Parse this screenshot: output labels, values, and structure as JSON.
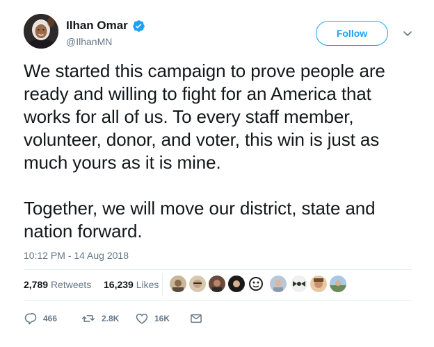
{
  "author": {
    "name": "Ilhan Omar",
    "handle": "@IlhanMN",
    "verified": true,
    "avatar_icon": "profile-photo"
  },
  "follow_label": "Follow",
  "tweet": {
    "paragraphs": [
      "We started this campaign to prove people are ready and willing to fight for an America that works for all of us. To every staff member, volunteer, donor, and voter, this win is just as much yours as it is mine.",
      "Together, we will move our district, state and nation forward."
    ],
    "timestamp": "10:12 PM - 14 Aug 2018"
  },
  "stats": {
    "retweets_count": "2,789",
    "retweets_label": "Retweets",
    "likes_count": "16,239",
    "likes_label": "Likes"
  },
  "actions": {
    "reply_count": "466",
    "retweet_count": "2.8K",
    "like_count": "16K"
  },
  "colors": {
    "accent": "#1da1f2",
    "text": "#14171a",
    "muted": "#657786",
    "divider": "#e6ecf0"
  },
  "icons": {
    "verified": "verified-badge-icon",
    "caret": "chevron-down-icon",
    "reply": "reply-icon",
    "retweet": "retweet-icon",
    "like": "heart-icon",
    "message": "envelope-icon"
  }
}
